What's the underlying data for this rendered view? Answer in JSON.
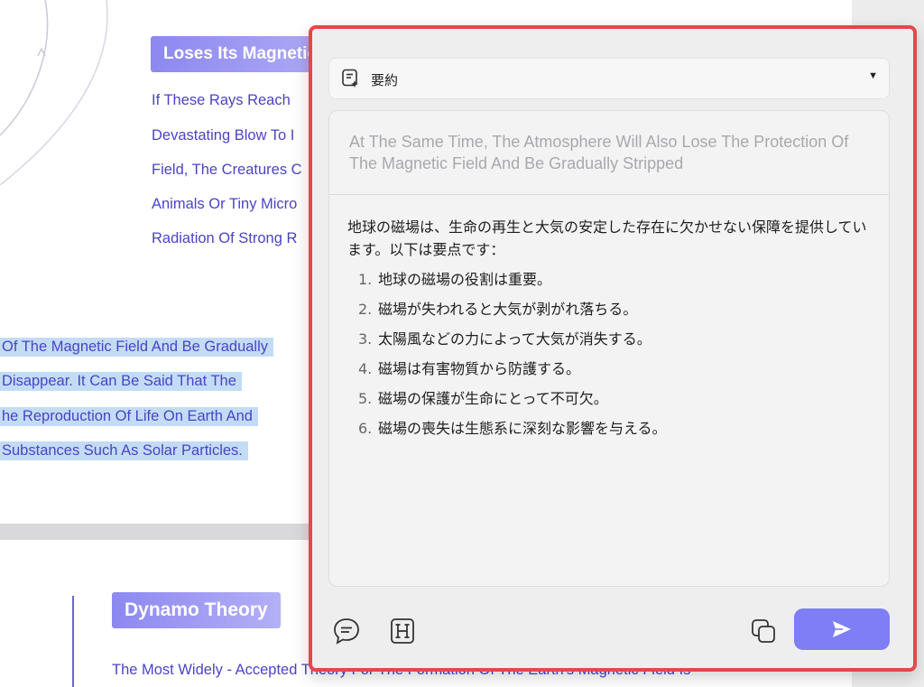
{
  "document": {
    "heading_1": "Loses Its Magnetic",
    "lines_1": [
      "If These Rays Reach",
      "Devastating Blow To I",
      "Field, The Creatures C",
      "Animals Or Tiny Micro",
      "Radiation Of Strong R"
    ],
    "selected_lines": [
      "Of The Magnetic Field And Be Gradually",
      "Disappear. It Can Be Said That The",
      "he Reproduction Of Life On Earth And",
      "Substances Such As Solar Particles."
    ],
    "heading_2": "Dynamo Theory",
    "bottom_line": "The Most Widely - Accepted Theory For The Formation Of The Earth's Magnetic Field Is"
  },
  "ai_panel": {
    "mode": {
      "label": "要約",
      "icon": "summarize-icon"
    },
    "source_text": "At The Same Time, The Atmosphere Will Also Lose The Protection Of The Magnetic Field And Be Gradually Stripped",
    "summary_intro": "地球の磁場は、生命の再生と大気の安定した存在に欠かせない保障を提供しています。以下は要点です：",
    "summary_items": [
      {
        "num": "1.",
        "text": "地球の磁場の役割は重要。"
      },
      {
        "num": "2.",
        "text": "磁場が失われると大気が剥がれ落ちる。"
      },
      {
        "num": "3.",
        "text": "太陽風などの力によって大気が消失する。"
      },
      {
        "num": "4.",
        "text": "磁場は有害物質から防護する。"
      },
      {
        "num": "5.",
        "text": "磁場の保護が生命にとって不可欠。"
      },
      {
        "num": "6.",
        "text": "磁場の喪失は生態系に深刻な影響を与える。"
      }
    ],
    "toolbar": {
      "chat_icon": "chat-icon",
      "heading_icon": "heading-icon",
      "copy_icon": "copy-icon",
      "send_icon": "send-icon"
    },
    "colors": {
      "highlight_border": "#e4484a",
      "send_button": "#7f7ef6",
      "link_text": "#4a44c6",
      "selection": "#c3dcf5"
    }
  }
}
